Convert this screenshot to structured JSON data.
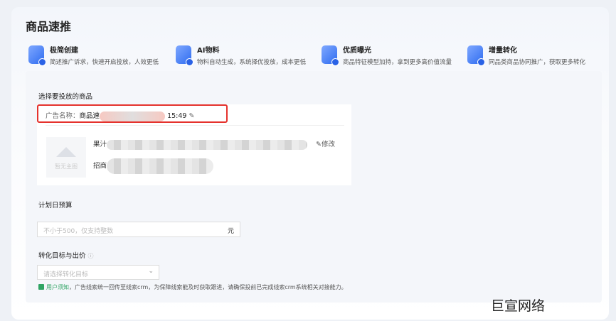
{
  "title": "商品速推",
  "features": [
    {
      "title": "极简创建",
      "desc": "简述推广诉求，快速开启投放，人效更低",
      "icon": "rocket-icon"
    },
    {
      "title": "AI物料",
      "desc": "物料自动生成，系统择优投放，成本更低",
      "icon": "ai-icon"
    },
    {
      "title": "优质曝光",
      "desc": "商品特征模型加持，拿到更多高价值流量",
      "icon": "play-icon"
    },
    {
      "title": "增量转化",
      "desc": "同品类商品协同推广，获取更多转化",
      "icon": "chart-icon"
    }
  ],
  "product_section": {
    "label": "选择要投放的商品",
    "ad_name_label": "广告名称：",
    "ad_name_prefix": "商品速",
    "ad_name_suffix": "15:49",
    "thumb_text": "暂无主图",
    "product_title_prefix": "果汁",
    "product_sub_prefix": "招商",
    "edit_label": "修改"
  },
  "budget": {
    "label": "计划日预算",
    "placeholder": "不小于500，仅支持整数",
    "unit": "元"
  },
  "conversion": {
    "label": "转化目标与出价",
    "placeholder": "请选择转化目标",
    "notice_link": "用户须知",
    "notice_text": "，广告线索统一回传至线索crm，为保障线索能及时获取跟进，请确保投前已完成线索crm系统相关对接能力。"
  },
  "watermark": "巨宣网络"
}
